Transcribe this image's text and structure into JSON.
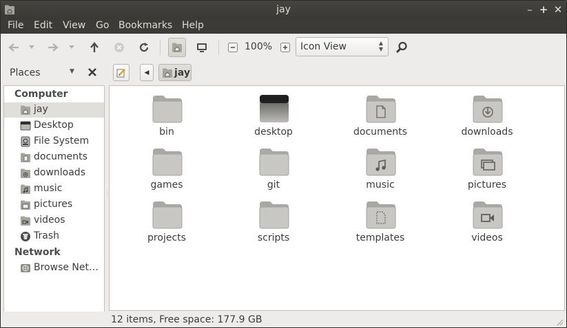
{
  "window": {
    "title": "jay"
  },
  "menubar": {
    "items": [
      "File",
      "Edit",
      "View",
      "Go",
      "Bookmarks",
      "Help"
    ]
  },
  "toolbar": {
    "zoom_level": "100%",
    "view_mode": "Icon View"
  },
  "locationbar": {
    "sidebar_selector": "Places",
    "breadcrumb": "jay"
  },
  "sidebar": {
    "sections": [
      {
        "heading": "Computer",
        "items": [
          {
            "label": "jay",
            "icon": "home-folder-icon",
            "selected": true
          },
          {
            "label": "Desktop",
            "icon": "desktop-icon"
          },
          {
            "label": "File System",
            "icon": "drive-icon"
          },
          {
            "label": "documents",
            "icon": "documents-folder-icon"
          },
          {
            "label": "downloads",
            "icon": "downloads-folder-icon"
          },
          {
            "label": "music",
            "icon": "music-folder-icon"
          },
          {
            "label": "pictures",
            "icon": "pictures-folder-icon"
          },
          {
            "label": "videos",
            "icon": "videos-folder-icon"
          },
          {
            "label": "Trash",
            "icon": "trash-icon"
          }
        ]
      },
      {
        "heading": "Network",
        "items": [
          {
            "label": "Browse Net…",
            "icon": "network-icon"
          }
        ]
      }
    ]
  },
  "main": {
    "items": [
      {
        "name": "bin",
        "icon": "folder-icon"
      },
      {
        "name": "desktop",
        "icon": "desktop-folder-icon"
      },
      {
        "name": "documents",
        "icon": "documents-folder-icon"
      },
      {
        "name": "downloads",
        "icon": "downloads-folder-icon"
      },
      {
        "name": "games",
        "icon": "folder-icon"
      },
      {
        "name": "git",
        "icon": "folder-icon"
      },
      {
        "name": "music",
        "icon": "music-folder-icon"
      },
      {
        "name": "pictures",
        "icon": "pictures-folder-icon"
      },
      {
        "name": "projects",
        "icon": "folder-icon"
      },
      {
        "name": "scripts",
        "icon": "folder-icon"
      },
      {
        "name": "templates",
        "icon": "templates-folder-icon"
      },
      {
        "name": "videos",
        "icon": "videos-folder-icon"
      }
    ]
  },
  "status": {
    "text": "12 items, Free space: 177.9 GB"
  },
  "colors": {
    "titlebar": "#3c3b37",
    "window_bg": "#edecea",
    "menu_text": "#dfdbd2",
    "folder": "#b4b4b4"
  }
}
